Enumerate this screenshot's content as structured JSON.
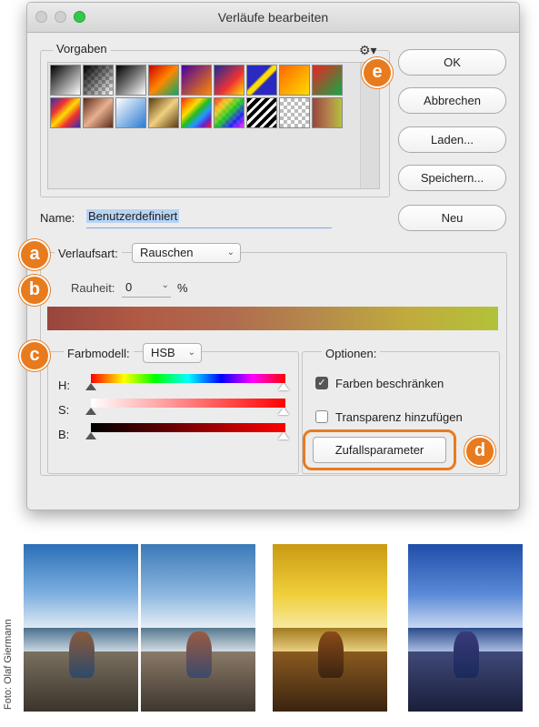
{
  "window": {
    "title": "Verläufe bearbeiten"
  },
  "presets": {
    "legend": "Vorgaben",
    "gear_icon": "gear-icon"
  },
  "buttons": {
    "ok": "OK",
    "cancel": "Abbrechen",
    "load": "Laden...",
    "save": "Speichern...",
    "new": "Neu"
  },
  "name": {
    "label": "Name:",
    "value": "Benutzerdefiniert"
  },
  "gradient_type": {
    "label": "Verlaufsart:",
    "value": "Rauschen"
  },
  "roughness": {
    "label": "Rauheit:",
    "value": "0",
    "unit": "%"
  },
  "color_model": {
    "label": "Farbmodell:",
    "value": "HSB",
    "channels": [
      {
        "label": "H:"
      },
      {
        "label": "S:"
      },
      {
        "label": "B:"
      }
    ]
  },
  "options": {
    "legend": "Optionen:",
    "restrict_colors": {
      "label": "Farben beschränken",
      "checked": true
    },
    "add_transparency": {
      "label": "Transparenz hinzufügen",
      "checked": false
    },
    "randomize": "Zufallsparameter"
  },
  "badges": {
    "a": "a",
    "b": "b",
    "c": "c",
    "d": "d",
    "e": "e"
  },
  "accent_color": "#e87b1e",
  "photo_credit": "Foto: Olaf Giermann"
}
